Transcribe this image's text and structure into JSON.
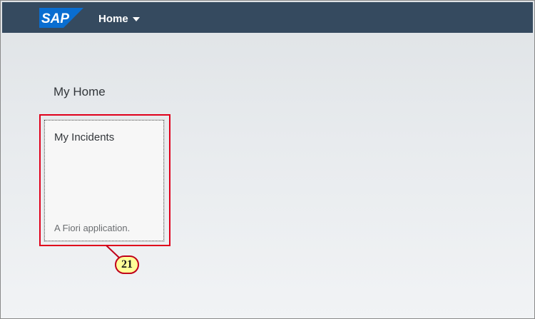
{
  "shell": {
    "logo_text": "SAP",
    "home_menu_label": "Home",
    "brand_color": "#354a5f",
    "logo_color": "#0a6ed1"
  },
  "page": {
    "group_title": "My Home"
  },
  "tile": {
    "title": "My Incidents",
    "footer": "A Fiori application."
  },
  "annotation": {
    "callout_number": "21",
    "highlight_color": "#e0001b",
    "callout_fill": "#ffff99"
  }
}
